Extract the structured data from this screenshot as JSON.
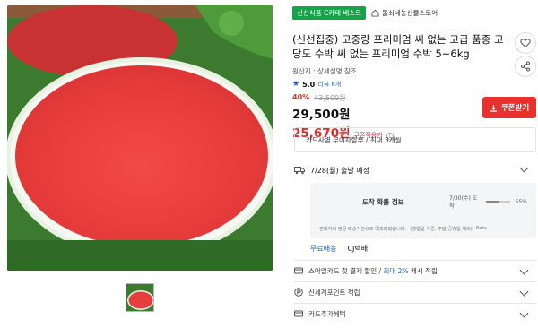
{
  "product": {
    "badge": "신선식품 C카테 베스트",
    "store": "돌쇠네농산물스토어",
    "title": "(신선집중) 고중량 프리미엄 씨 없는 고급 품종 고당도 수박 씨 없는 프리미엄 수박 5~6kg",
    "origin": "원산지 : 상세설명 참조",
    "rating_score": "5.0",
    "rating_count": "리뷰 6개",
    "discount_pct": "40%",
    "original_price": "43,500원",
    "price": "29,500원",
    "coupon_price": "25,670원",
    "coupon_note": "쿠폰적용가",
    "coupon_button": "쿠폰받기"
  },
  "card_installment": "카드사별 무이자할부 / 최대 3개월",
  "shipping": {
    "date": "7/28(월) 출발 예정",
    "arrival_title": "도착 확률 정보",
    "arrival_date": "7/30(수) 도착",
    "arrival_pct": "55%",
    "arrival_pct_value": 0.55,
    "arrival_note_left": "판매자의 평균 배송기간으로 예측되었습니다.",
    "arrival_note_right": "(영업일 기준, 주말/공휴일 제외)",
    "arrival_note_tag": "Beta",
    "free_label": "무료배송",
    "carrier": "CJ택배"
  },
  "benefits": [
    {
      "prefix": "스마일카드 첫 결제 할인 / ",
      "highlight": "최대 2%",
      "suffix": " 캐시 적립",
      "icon": "card-icon"
    },
    {
      "prefix": "신세계포인트 적립",
      "highlight": "",
      "suffix": "",
      "icon": "point-icon"
    },
    {
      "prefix": "카드추가혜택",
      "highlight": "",
      "suffix": "",
      "icon": "card-icon"
    }
  ],
  "colors": {
    "accent_red": "#e8312e",
    "link_blue": "#1c5fcf",
    "badge_green": "#17a34a"
  }
}
